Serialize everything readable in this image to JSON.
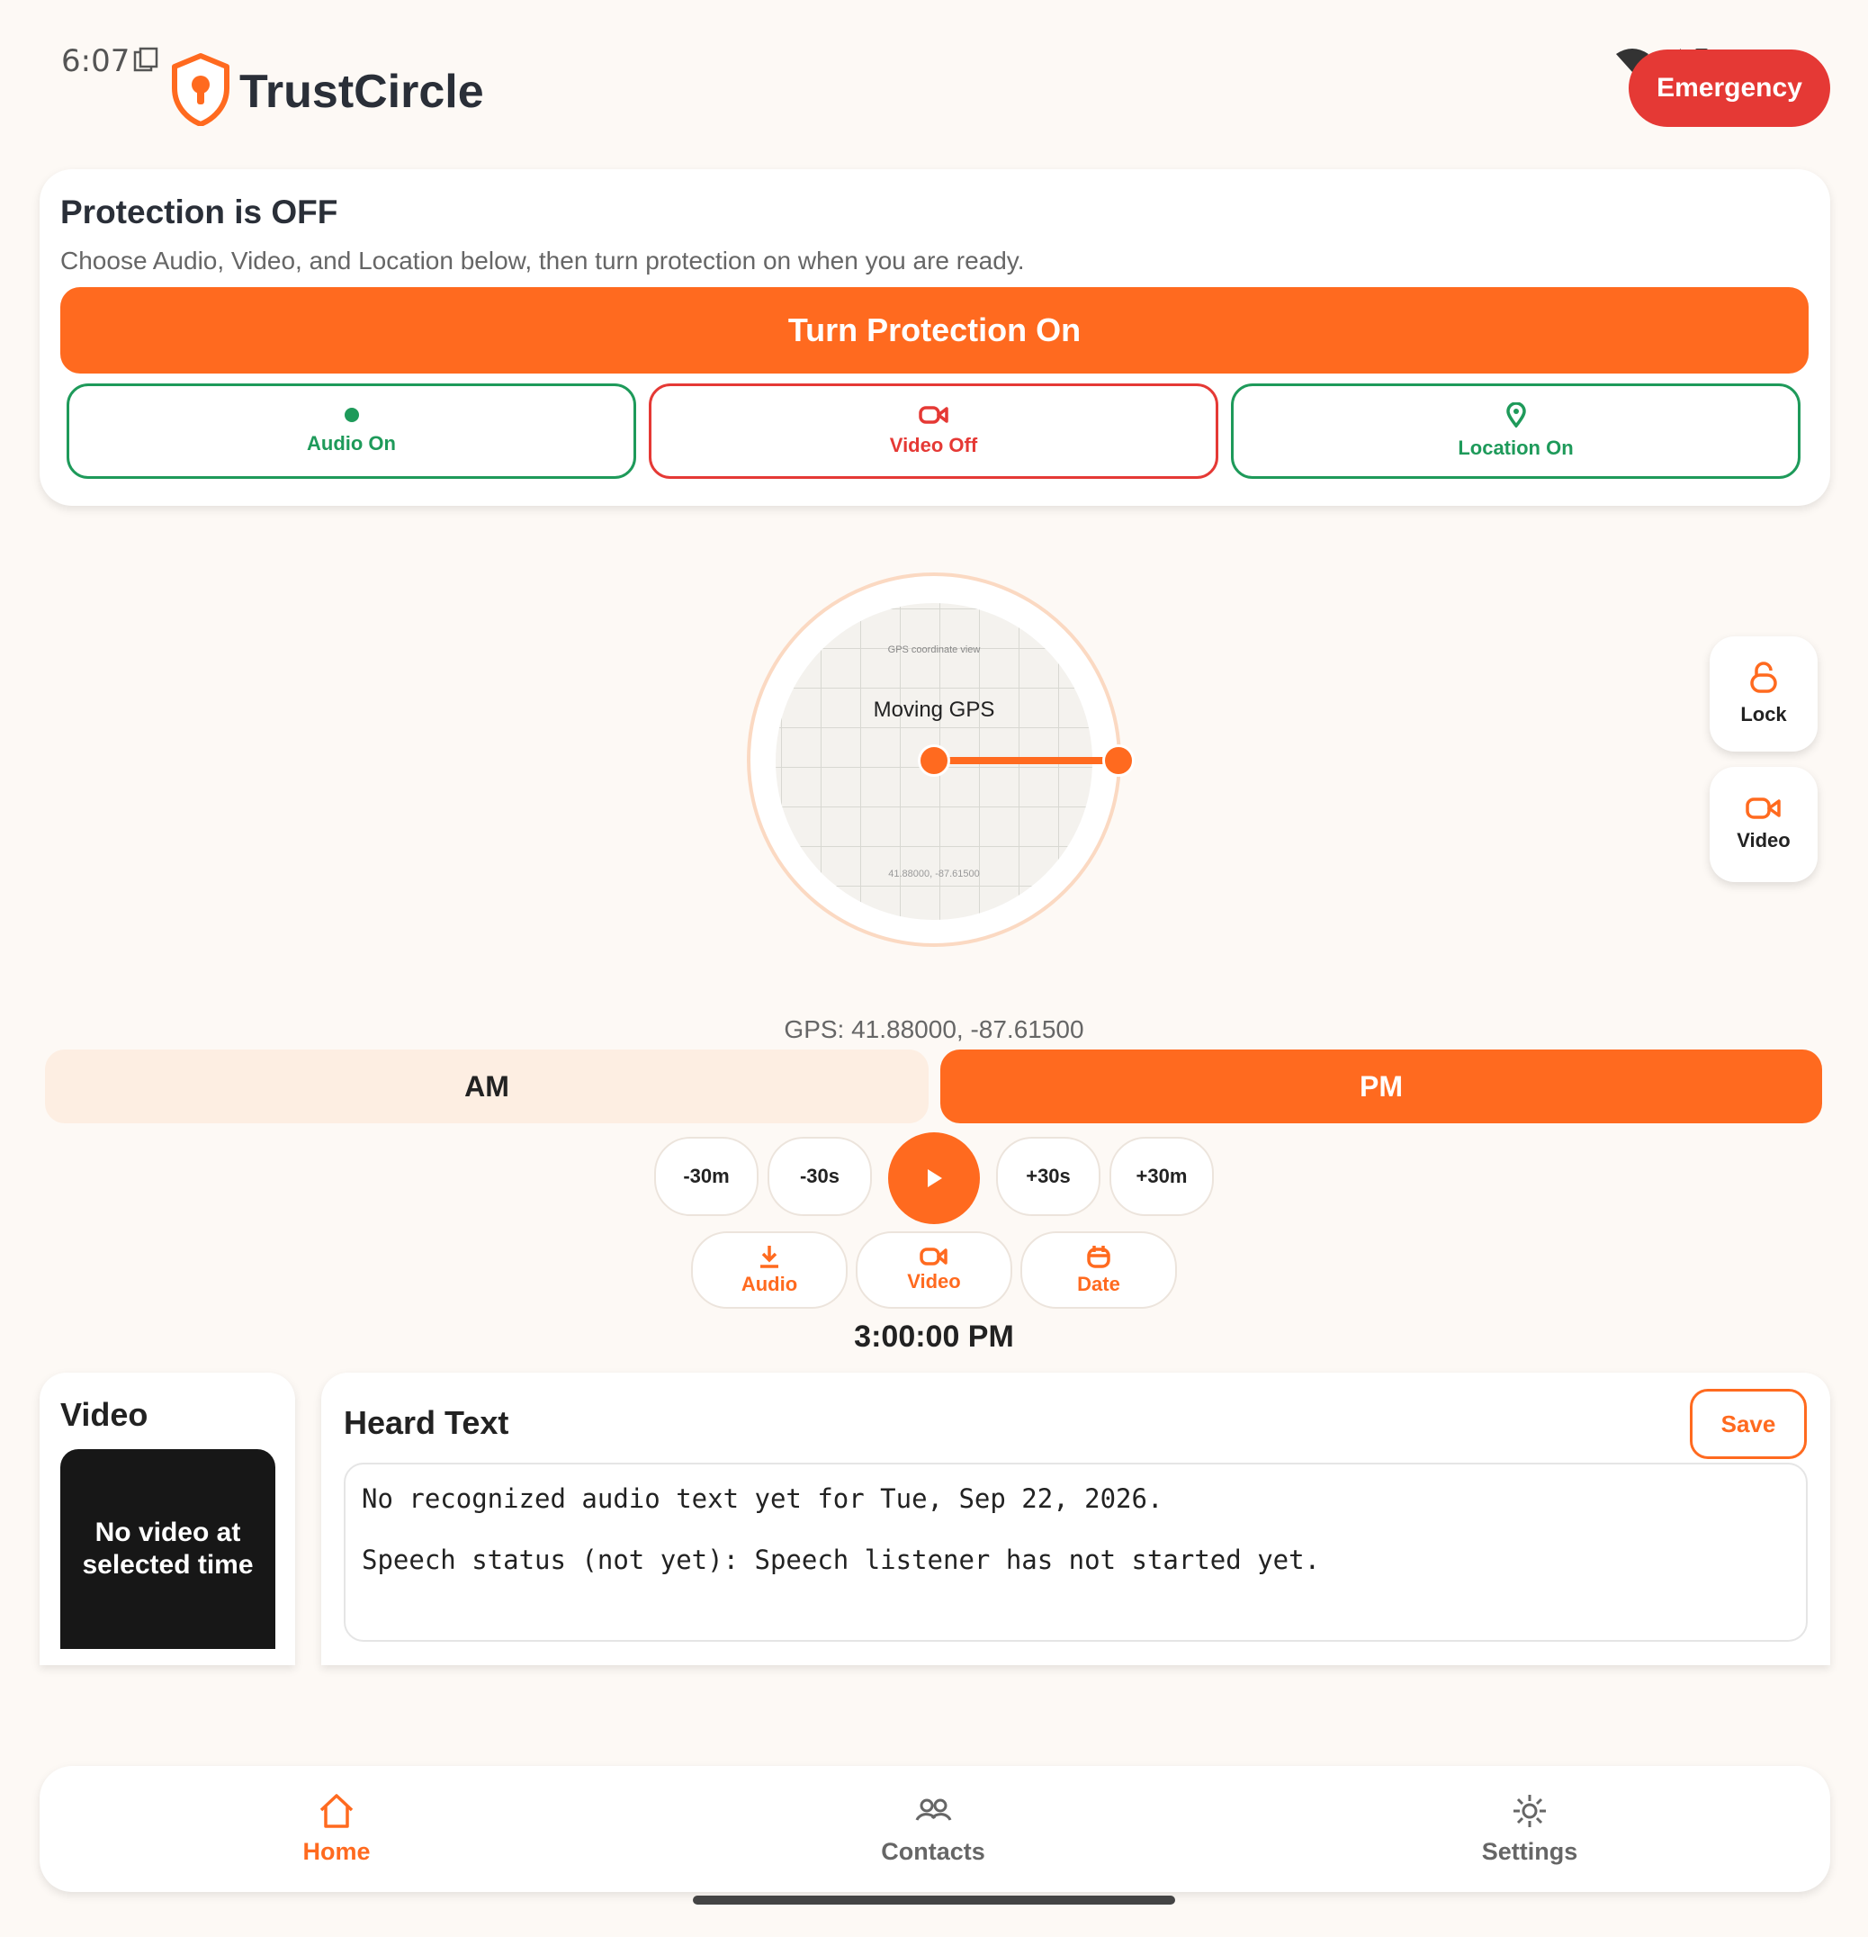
{
  "status_bar": {
    "time": "6:07"
  },
  "header": {
    "app_title": "TrustCircle",
    "emergency_label": "Emergency"
  },
  "protection": {
    "title": "Protection is OFF",
    "subtitle": "Choose Audio, Video, and Location below, then turn protection on when you are ready.",
    "turn_on_label": "Turn Protection On",
    "toggles": [
      {
        "label": "Audio On",
        "icon": "dot-icon",
        "color": "#1e9a5a"
      },
      {
        "label": "Video Off",
        "icon": "video-camera-icon",
        "color": "#e53935"
      },
      {
        "label": "Location On",
        "icon": "location-pin-icon",
        "color": "#1e9a5a"
      }
    ]
  },
  "map": {
    "caption": "GPS coordinate view",
    "status": "Moving GPS",
    "coords_small": "41.88000, -87.61500"
  },
  "side_actions": {
    "lock_label": "Lock",
    "video_label": "Video"
  },
  "gps_text": "GPS: 41.88000, -87.61500",
  "period": {
    "am_label": "AM",
    "pm_label": "PM",
    "selected": "PM"
  },
  "seek": {
    "minus_30m": "-30m",
    "minus_30s": "-30s",
    "plus_30s": "+30s",
    "plus_30m": "+30m"
  },
  "exports": {
    "audio_label": "Audio",
    "video_label": "Video",
    "date_label": "Date"
  },
  "selected_time": "3:00:00 PM",
  "video_panel": {
    "title": "Video",
    "empty_message": "No video at selected time"
  },
  "heard_text": {
    "title": "Heard Text",
    "save_label": "Save",
    "line1": "No recognized audio text yet for Tue, Sep 22, 2026.",
    "line2": "Speech status (not yet): Speech listener has not started yet."
  },
  "bottom_nav": {
    "home_label": "Home",
    "contacts_label": "Contacts",
    "settings_label": "Settings",
    "active": "Home"
  },
  "colors": {
    "accent": "#ff6a1f",
    "emergency": "#e53935",
    "on": "#1e9a5a",
    "background": "#fdf9f5"
  }
}
